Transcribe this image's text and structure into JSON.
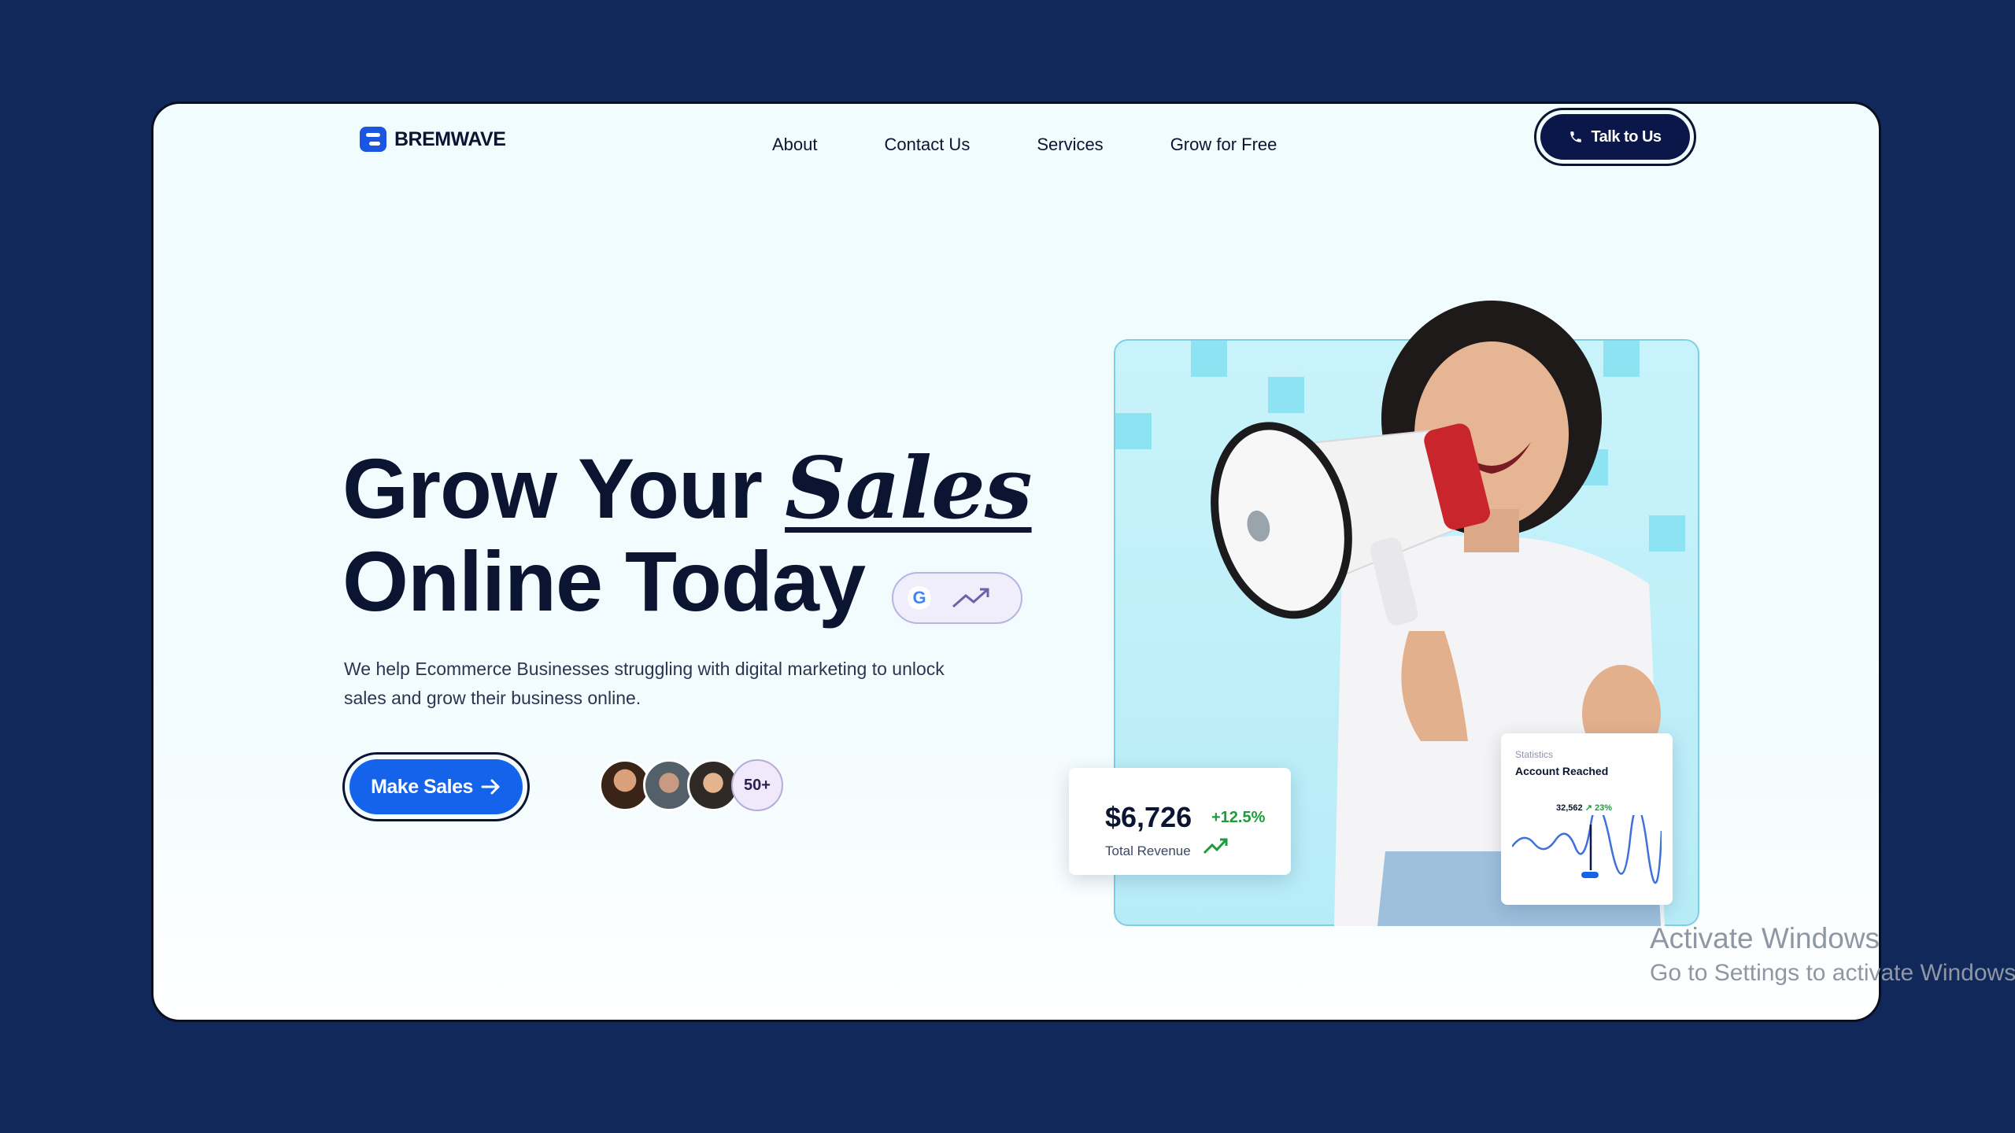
{
  "brand": {
    "name": "BREMWAVE"
  },
  "nav": {
    "items": [
      "About",
      "Contact Us",
      "Services",
      "Grow for Free"
    ],
    "cta_label": "Talk to Us"
  },
  "hero": {
    "headline_part1": "Grow Your ",
    "headline_accent": "Sales",
    "headline_line2": "Online Today",
    "subtext": "We help Ecommerce Businesses struggling with digital marketing to unlock sales and grow their business online.",
    "button_label": "Make Sales",
    "avatar_count": "50+"
  },
  "revenue_card": {
    "value": "$6,726",
    "change": "+12.5%",
    "label": "Total Revenue"
  },
  "reach_card": {
    "small_label": "Statistics",
    "title": "Account Reached",
    "value": "32,562",
    "change": "↗ 23%"
  },
  "watermark": {
    "line1": "Activate Windows",
    "line2": "Go to Settings to activate Windows."
  },
  "colors": {
    "page_bg": "#10295a",
    "primary": "#1463ea",
    "dark": "#0b1748",
    "accent_green": "#1c9c3a"
  }
}
